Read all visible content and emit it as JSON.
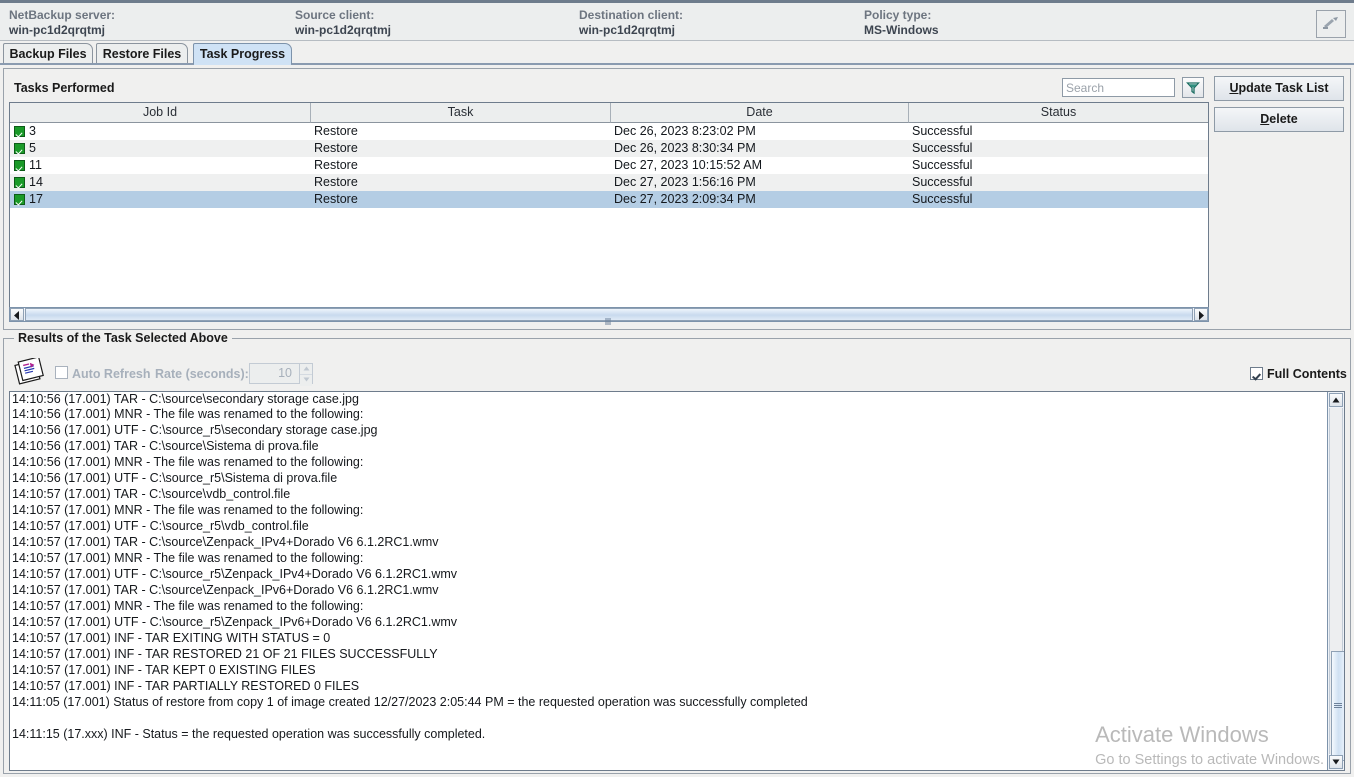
{
  "header": {
    "fields": [
      {
        "label": "NetBackup server:",
        "value": "win-pc1d2qrqtmj"
      },
      {
        "label": "Source client:",
        "value": "win-pc1d2qrqtmj"
      },
      {
        "label": "Destination client:",
        "value": "win-pc1d2qrqtmj"
      },
      {
        "label": "Policy type:",
        "value": "MS-Windows"
      }
    ],
    "corner_icon": "antenna-icon"
  },
  "tabs": [
    {
      "label": "Backup Files",
      "active": false
    },
    {
      "label": "Restore Files",
      "active": false
    },
    {
      "label": "Task Progress",
      "active": true
    }
  ],
  "tasks_panel": {
    "title": "Tasks Performed",
    "search": {
      "placeholder": "Search",
      "value": ""
    },
    "filter_icon": "funnel-icon",
    "buttons": {
      "update": {
        "mnemonic": "U",
        "rest": "pdate Task List"
      },
      "delete": {
        "mnemonic": "D",
        "rest": "elete"
      }
    },
    "columns": [
      "Job Id",
      "Task",
      "Date",
      "Status"
    ],
    "rows": [
      {
        "icon": "green-check-icon",
        "job_id": "3",
        "task": "Restore",
        "date": "Dec 26, 2023 8:23:02 PM",
        "status": "Successful",
        "selected": false
      },
      {
        "icon": "green-check-icon",
        "job_id": "5",
        "task": "Restore",
        "date": "Dec 26, 2023 8:30:34 PM",
        "status": "Successful",
        "selected": false
      },
      {
        "icon": "green-check-icon",
        "job_id": "11",
        "task": "Restore",
        "date": "Dec 27, 2023 10:15:52 AM",
        "status": "Successful",
        "selected": false
      },
      {
        "icon": "green-check-icon",
        "job_id": "14",
        "task": "Restore",
        "date": "Dec 27, 2023 1:56:16 PM",
        "status": "Successful",
        "selected": false
      },
      {
        "icon": "green-check-icon",
        "job_id": "17",
        "task": "Restore",
        "date": "Dec 27, 2023 2:09:34 PM",
        "status": "Successful",
        "selected": true
      }
    ]
  },
  "results_panel": {
    "legend": "Results of the Task Selected Above",
    "docs_icon": "documents-icon",
    "auto_refresh": {
      "label": "Auto Refresh",
      "checked": false,
      "enabled": false
    },
    "rate": {
      "label": "Rate (seconds):",
      "value": "10",
      "enabled": false
    },
    "full_contents": {
      "label": "Full Contents",
      "checked": true
    },
    "log_lines": [
      "14:10:56 (17.001) TAR - C:\\source\\secondary storage case.jpg",
      "14:10:56 (17.001) MNR - The file was renamed to the following:",
      "14:10:56 (17.001) UTF - C:\\source_r5\\secondary storage case.jpg",
      "14:10:56 (17.001) TAR - C:\\source\\Sistema di prova.file",
      "14:10:56 (17.001) MNR - The file was renamed to the following:",
      "14:10:56 (17.001) UTF - C:\\source_r5\\Sistema di prova.file",
      "14:10:57 (17.001) TAR - C:\\source\\vdb_control.file",
      "14:10:57 (17.001) MNR - The file was renamed to the following:",
      "14:10:57 (17.001) UTF - C:\\source_r5\\vdb_control.file",
      "14:10:57 (17.001) TAR - C:\\source\\Zenpack_IPv4+Dorado V6 6.1.2RC1.wmv",
      "14:10:57 (17.001) MNR - The file was renamed to the following:",
      "14:10:57 (17.001) UTF - C:\\source_r5\\Zenpack_IPv4+Dorado V6 6.1.2RC1.wmv",
      "14:10:57 (17.001) TAR - C:\\source\\Zenpack_IPv6+Dorado V6 6.1.2RC1.wmv",
      "14:10:57 (17.001) MNR - The file was renamed to the following:",
      "14:10:57 (17.001) UTF - C:\\source_r5\\Zenpack_IPv6+Dorado V6 6.1.2RC1.wmv",
      "14:10:57 (17.001) INF - TAR EXITING WITH STATUS = 0",
      "14:10:57 (17.001) INF - TAR RESTORED 21 OF 21 FILES SUCCESSFULLY",
      "14:10:57 (17.001) INF - TAR KEPT 0 EXISTING FILES",
      "14:10:57 (17.001) INF - TAR PARTIALLY RESTORED 0 FILES",
      "14:11:05 (17.001) Status of restore from copy 1 of image created 12/27/2023 2:05:44 PM = the requested operation was successfully completed",
      "",
      "14:11:15 (17.xxx) INF - Status = the requested operation was successfully completed."
    ]
  },
  "watermark": {
    "title": "Activate Windows",
    "subtitle": "Go to Settings to activate Windows."
  }
}
